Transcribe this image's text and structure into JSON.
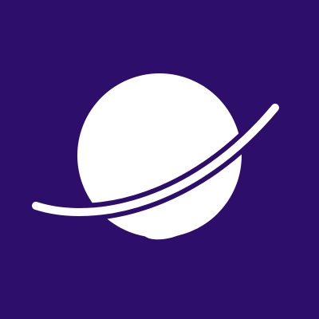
{
  "icon": {
    "name": "planet-icon",
    "background_color": "#2d0f6b",
    "foreground_color": "#ffffff"
  }
}
